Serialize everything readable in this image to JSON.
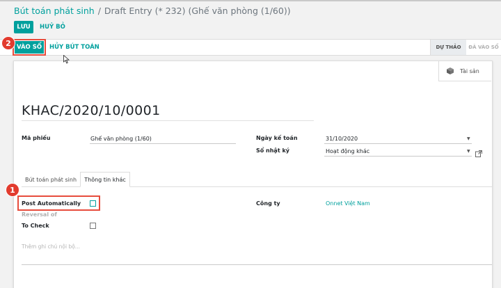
{
  "breadcrumb": {
    "parent": "Bút toán phát sinh",
    "separator": "/",
    "current": "Draft Entry (* 232) (Ghế văn phòng (1/60))"
  },
  "actions": {
    "save_label": "LƯU",
    "discard_label": "HUỶ BỎ"
  },
  "statusbar": {
    "post_label": "VÀO SỔ",
    "cancel_entry_label": "HỦY BÚT TOÁN",
    "stages": [
      "DỰ THẢO",
      "ĐÃ VÀO SỔ"
    ],
    "active_stage": "DỰ THẢO"
  },
  "smart_button": {
    "label": "Tài sản",
    "icon": "cube-icon"
  },
  "entry": {
    "name": "KHAC/2020/10/0001"
  },
  "fields": {
    "ref_label": "Mã phiếu",
    "ref_value": "Ghế văn phòng (1/60)",
    "date_label": "Ngày kế toán",
    "date_value": "31/10/2020",
    "journal_label": "Sổ nhật ký",
    "journal_value": "Hoạt động khác"
  },
  "tabs": [
    "Bút toán phát sinh",
    "Thông tin khác"
  ],
  "active_tab": "Thông tin khác",
  "other_info": {
    "post_auto_label": "Post Automatically",
    "post_auto_checked": false,
    "reversal_label": "Reversal of",
    "to_check_label": "To Check",
    "to_check_checked": false,
    "company_label": "Công ty",
    "company_value": "Onnet Việt Nam",
    "narration_placeholder": "Thêm ghi chú nội bộ..."
  },
  "annotations": {
    "badge_1": "1",
    "badge_2": "2",
    "highlight_color": "#e74c3c"
  },
  "colors": {
    "accent": "#00a09d",
    "badge": "#e23b2e"
  }
}
